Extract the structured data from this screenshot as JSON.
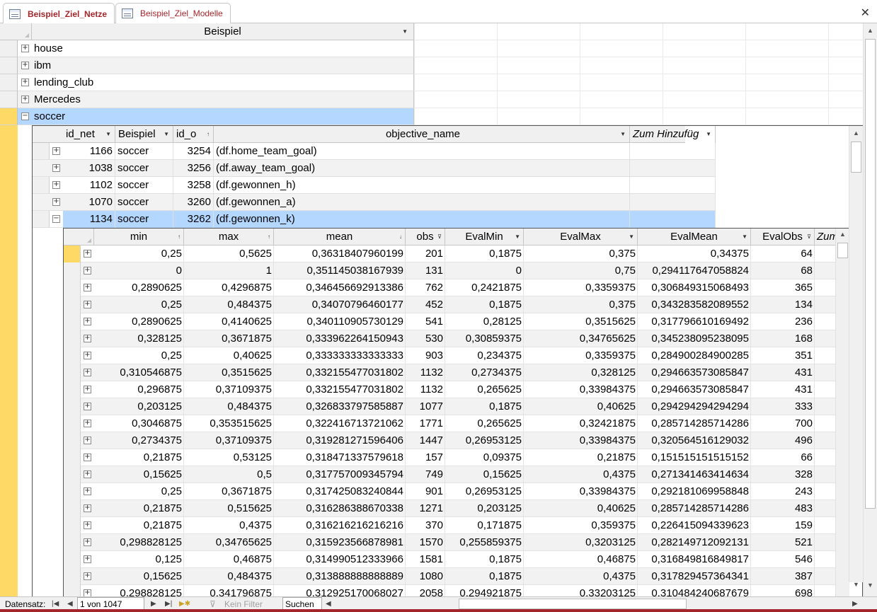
{
  "tabs": [
    {
      "label": "Beispiel_Ziel_Netze",
      "active": true
    },
    {
      "label": "Beispiel_Ziel_Modelle",
      "active": false
    }
  ],
  "main_table": {
    "column": "Beispiel",
    "rows": [
      "house",
      "ibm",
      "lending_club",
      "Mercedes",
      "soccer"
    ],
    "selected_row": "soccer"
  },
  "sub_table": {
    "columns": [
      "id_net",
      "Beispiel",
      "id_o",
      "objective_name",
      "Zum Hinzufüg"
    ],
    "rows": [
      {
        "id_net": "1166",
        "beispiel": "soccer",
        "id_o": "3254",
        "objective_name": "(df.home_team_goal)"
      },
      {
        "id_net": "1038",
        "beispiel": "soccer",
        "id_o": "3256",
        "objective_name": "(df.away_team_goal)"
      },
      {
        "id_net": "1102",
        "beispiel": "soccer",
        "id_o": "3258",
        "objective_name": "(df.gewonnen_h)"
      },
      {
        "id_net": "1070",
        "beispiel": "soccer",
        "id_o": "3260",
        "objective_name": "(df.gewonnen_a)"
      },
      {
        "id_net": "1134",
        "beispiel": "soccer",
        "id_o": "3262",
        "objective_name": "(df.gewonnen_k)"
      }
    ]
  },
  "detail_table": {
    "columns": [
      "min",
      "max",
      "mean",
      "obs",
      "EvalMin",
      "EvalMax",
      "EvalMean",
      "EvalObs",
      "Zum"
    ],
    "rows": [
      [
        "0,25",
        "0,5625",
        "0,36318407960199",
        "201",
        "0,1875",
        "0,375",
        "0,34375",
        "64"
      ],
      [
        "0",
        "1",
        "0,351145038167939",
        "131",
        "0",
        "0,75",
        "0,294117647058824",
        "68"
      ],
      [
        "0,2890625",
        "0,4296875",
        "0,346456692913386",
        "762",
        "0,2421875",
        "0,3359375",
        "0,306849315068493",
        "365"
      ],
      [
        "0,25",
        "0,484375",
        "0,34070796460177",
        "452",
        "0,1875",
        "0,375",
        "0,343283582089552",
        "134"
      ],
      [
        "0,2890625",
        "0,4140625",
        "0,340110905730129",
        "541",
        "0,28125",
        "0,3515625",
        "0,317796610169492",
        "236"
      ],
      [
        "0,328125",
        "0,3671875",
        "0,333962264150943",
        "530",
        "0,30859375",
        "0,34765625",
        "0,345238095238095",
        "168"
      ],
      [
        "0,25",
        "0,40625",
        "0,333333333333333",
        "903",
        "0,234375",
        "0,3359375",
        "0,284900284900285",
        "351"
      ],
      [
        "0,310546875",
        "0,3515625",
        "0,332155477031802",
        "1132",
        "0,2734375",
        "0,328125",
        "0,294663573085847",
        "431"
      ],
      [
        "0,296875",
        "0,37109375",
        "0,332155477031802",
        "1132",
        "0,265625",
        "0,33984375",
        "0,294663573085847",
        "431"
      ],
      [
        "0,203125",
        "0,484375",
        "0,326833797585887",
        "1077",
        "0,1875",
        "0,40625",
        "0,294294294294294",
        "333"
      ],
      [
        "0,3046875",
        "0,353515625",
        "0,322416713721062",
        "1771",
        "0,265625",
        "0,32421875",
        "0,285714285714286",
        "700"
      ],
      [
        "0,2734375",
        "0,37109375",
        "0,319281271596406",
        "1447",
        "0,26953125",
        "0,33984375",
        "0,320564516129032",
        "496"
      ],
      [
        "0,21875",
        "0,53125",
        "0,318471337579618",
        "157",
        "0,09375",
        "0,21875",
        "0,151515151515152",
        "66"
      ],
      [
        "0,15625",
        "0,5",
        "0,317757009345794",
        "749",
        "0,15625",
        "0,4375",
        "0,271341463414634",
        "328"
      ],
      [
        "0,25",
        "0,3671875",
        "0,317425083240844",
        "901",
        "0,26953125",
        "0,33984375",
        "0,292181069958848",
        "243"
      ],
      [
        "0,21875",
        "0,515625",
        "0,316286388670338",
        "1271",
        "0,203125",
        "0,40625",
        "0,285714285714286",
        "483"
      ],
      [
        "0,21875",
        "0,4375",
        "0,316216216216216",
        "370",
        "0,171875",
        "0,359375",
        "0,226415094339623",
        "159"
      ],
      [
        "0,298828125",
        "0,34765625",
        "0,315923566878981",
        "1570",
        "0,255859375",
        "0,3203125",
        "0,282149712092131",
        "521"
      ],
      [
        "0,125",
        "0,46875",
        "0,314990512333966",
        "1581",
        "0,1875",
        "0,46875",
        "0,316849816849817",
        "546"
      ],
      [
        "0,15625",
        "0,484375",
        "0,313888888888889",
        "1080",
        "0,1875",
        "0,4375",
        "0,317829457364341",
        "387"
      ],
      [
        "0,298828125",
        "0,341796875",
        "0,312925170068027",
        "2058",
        "0,294921875",
        "0,33203125",
        "0,310484240687679",
        "698"
      ]
    ]
  },
  "status": {
    "label": "Datensatz:",
    "record": "1 von 1047",
    "filter": "Kein Filter",
    "search": "Suchen"
  },
  "colors": {
    "accent": "#a4262c",
    "selection": "#b4d7ff",
    "current_marker": "#ffd966"
  }
}
